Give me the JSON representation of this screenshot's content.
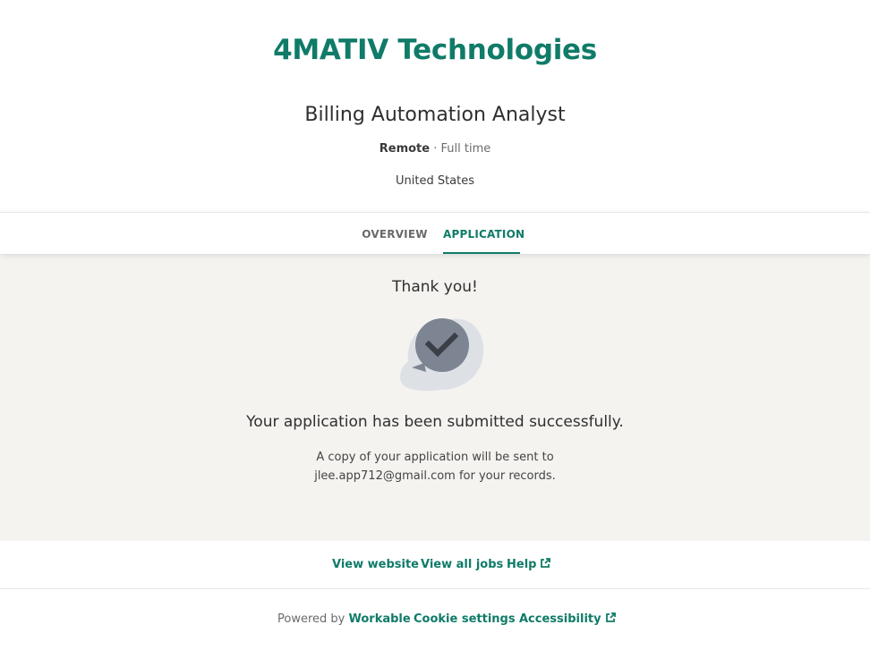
{
  "header": {
    "company": "4MATIV Technologies",
    "job_title": "Billing Automation Analyst",
    "workplace": "Remote",
    "separator": " · ",
    "employment_type": "Full time",
    "location": "United States"
  },
  "tabs": [
    {
      "label": "OVERVIEW",
      "active": false
    },
    {
      "label": "APPLICATION",
      "active": true
    }
  ],
  "confirmation": {
    "heading": "Thank you!",
    "icon": "chat-check-icon",
    "message": "Your application has been submitted successfully.",
    "note": "A copy of your application will be sent to jlee.app712@gmail.com for your records."
  },
  "links": {
    "view_website": "View website",
    "view_all_jobs": "View all jobs",
    "help": "Help"
  },
  "footer": {
    "powered_by": "Powered by ",
    "brand": "Workable",
    "cookie_settings": "Cookie settings",
    "accessibility": "Accessibility"
  },
  "colors": {
    "accent": "#0f7b68",
    "content_bg": "#f4f3f0",
    "icon_bubble": "#7d8592",
    "icon_shadow": "#dde1e6"
  }
}
